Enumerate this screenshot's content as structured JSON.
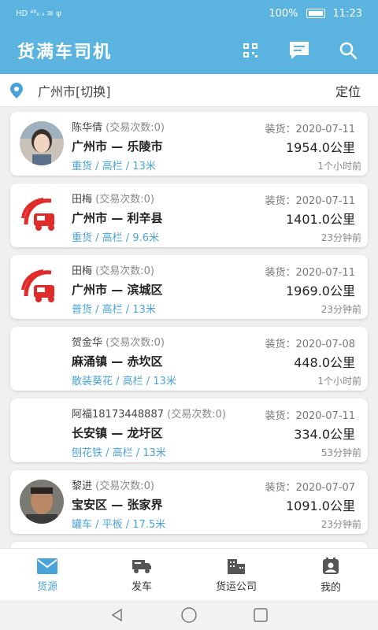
{
  "status": {
    "left": "HD ⁴⁶ᵢₗ ᵢₗ ≋ ψ",
    "battery": "100%",
    "time": "11:23"
  },
  "app": {
    "title": "货满车司机"
  },
  "location": {
    "city": "广州市[切换]",
    "locate": "定位"
  },
  "cards": [
    {
      "name": "陈华倩",
      "tx": "(交易次数:0)",
      "from": "广州市",
      "to": "乐陵市",
      "tags": "重货 / 高栏 / 13米",
      "load": "装货：2020-07-11",
      "distance": "1954.0公里",
      "ago": "1个小时前",
      "avatar": "photo-woman"
    },
    {
      "name": "田梅",
      "tx": "(交易次数:0)",
      "from": "广州市",
      "to": "利辛县",
      "tags": "重货 / 高栏 / 9.6米",
      "load": "装货：2020-07-11",
      "distance": "1401.0公里",
      "ago": "23分钟前",
      "avatar": "truck-logo"
    },
    {
      "name": "田梅",
      "tx": "(交易次数:0)",
      "from": "广州市",
      "to": "滨城区",
      "tags": "普货 / 高栏 / 13米",
      "load": "装货：2020-07-11",
      "distance": "1969.0公里",
      "ago": "23分钟前",
      "avatar": "truck-logo"
    },
    {
      "name": "贺金华",
      "tx": "(交易次数:0)",
      "from": "麻涌镇",
      "to": "赤坎区",
      "tags": "散装葵花 / 高栏 / 13米",
      "load": "装货：2020-07-08",
      "distance": "448.0公里",
      "ago": "1个小时前",
      "avatar": "none"
    },
    {
      "name": "阿福18173448887",
      "tx": "(交易次数:0)",
      "from": "长安镇",
      "to": "龙圩区",
      "tags": "刨花铁 / 高栏 / 13米",
      "load": "装货：2020-07-11",
      "distance": "334.0公里",
      "ago": "53分钟前",
      "avatar": "none"
    },
    {
      "name": "黎进",
      "tx": "(交易次数:0)",
      "from": "宝安区",
      "to": "张家界",
      "tags": "罐车 / 平板 / 17.5米",
      "load": "装货：2020-07-07",
      "distance": "1091.0公里",
      "ago": "23分钟前",
      "avatar": "photo-man"
    }
  ],
  "route_sep": "—",
  "tabs": [
    {
      "label": "货源",
      "icon": "mail-icon",
      "active": true
    },
    {
      "label": "发车",
      "icon": "truck-icon",
      "active": false
    },
    {
      "label": "货运公司",
      "icon": "building-icon",
      "active": false
    },
    {
      "label": "我的",
      "icon": "contact-icon",
      "active": false
    }
  ],
  "colors": {
    "primary": "#5bb4e0",
    "accent": "#4aa3d8",
    "logo_red": "#e02b2b"
  }
}
